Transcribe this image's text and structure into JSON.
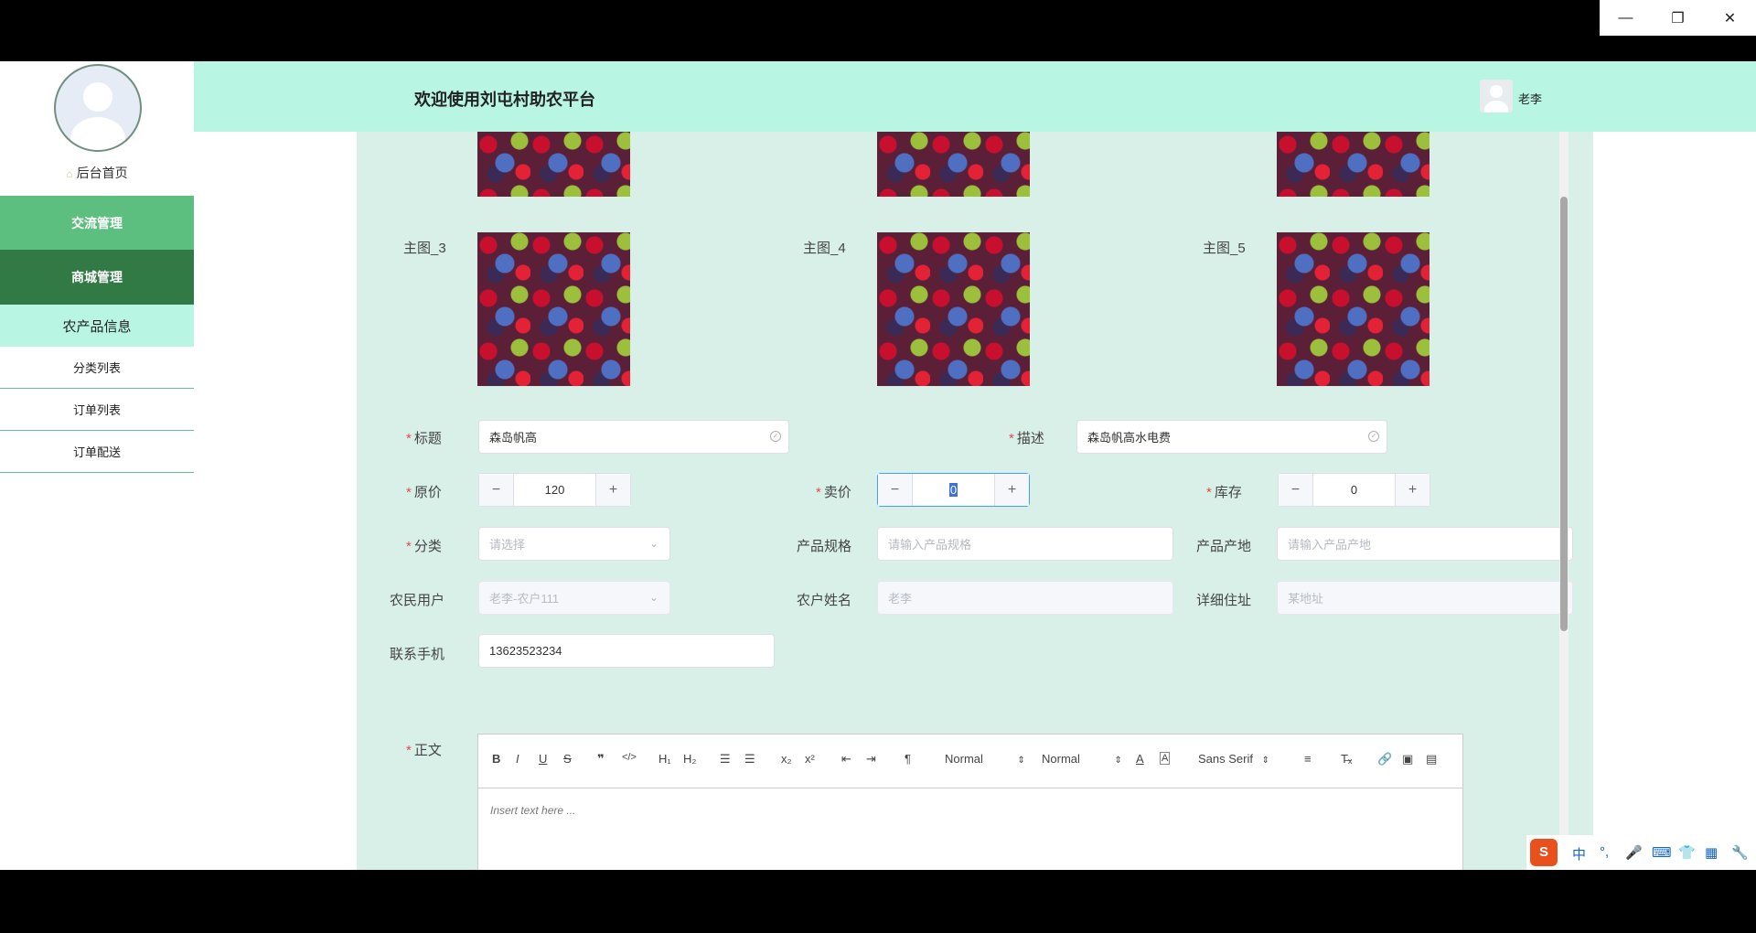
{
  "window": {
    "minimize": "—",
    "restore": "❐",
    "close": "✕"
  },
  "sidebar": {
    "home": "后台首页",
    "items": [
      {
        "label": "交流管理",
        "bg": "#5dbf7f",
        "color": "#ffffff"
      },
      {
        "label": "商城管理",
        "bg": "#327a45",
        "color": "#ffffff"
      },
      {
        "label": "农产品信息",
        "bg": "#b8f5e2",
        "color": "#222222"
      },
      {
        "label": "分类列表",
        "bg": "#ffffff",
        "color": "#222222"
      },
      {
        "label": "订单列表",
        "bg": "#ffffff",
        "color": "#222222"
      },
      {
        "label": "订单配送",
        "bg": "#ffffff",
        "color": "#222222"
      }
    ]
  },
  "header": {
    "title": "欢迎使用刘屯村助农平台",
    "user": "老李"
  },
  "images": {
    "main3": "主图_3",
    "main4": "主图_4",
    "main5": "主图_5"
  },
  "form": {
    "title_label": "标题",
    "title_value": "森岛帆高",
    "desc_label": "描述",
    "desc_value": "森岛帆高水电费",
    "orig_price_label": "原价",
    "orig_price_value": "120",
    "sale_price_label": "卖价",
    "sale_price_value": "0",
    "stock_label": "库存",
    "stock_value": "0",
    "category_label": "分类",
    "category_placeholder": "请选择",
    "spec_label": "产品规格",
    "spec_placeholder": "请输入产品规格",
    "origin_label": "产品产地",
    "origin_placeholder": "请输入产品产地",
    "farmer_user_label": "农民用户",
    "farmer_user_value": "老李-农户111",
    "farmer_name_label": "农户姓名",
    "farmer_name_value": "老李",
    "address_label": "详细住址",
    "address_value": "某地址",
    "phone_label": "联系手机",
    "phone_value": "13623523234",
    "body_label": "正文"
  },
  "editor": {
    "size1": "Normal",
    "size2": "Normal",
    "font": "Sans Serif",
    "placeholder": "Insert text here ..."
  },
  "colors": {
    "header_bg": "#b8f5e2",
    "form_bg": "#d9f0e9",
    "required": "#e64a4a",
    "focus": "#409eff"
  },
  "ime": {
    "logo": "S",
    "mode": "中",
    "punct": "°,",
    "mic": "🎤",
    "keyboard": "⌨",
    "skin": "👕",
    "grid": "▦",
    "tools": "🔧"
  }
}
